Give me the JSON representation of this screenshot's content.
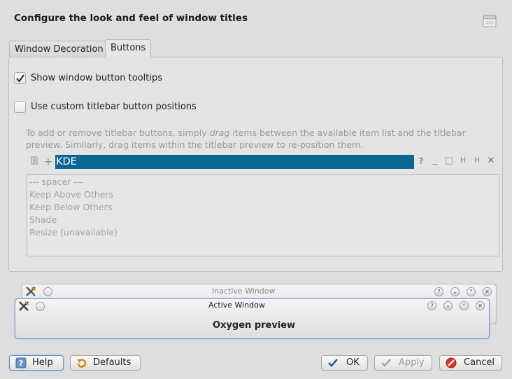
{
  "dialog": {
    "title": "Configure the look and feel of window titles"
  },
  "tabs": [
    {
      "label": "Window Decoration",
      "active": false
    },
    {
      "label": "Buttons",
      "active": true
    }
  ],
  "options": {
    "tooltips_label": "Show window button tooltips",
    "tooltips_checked": true,
    "custom_positions_label": "Use custom titlebar button positions",
    "custom_positions_checked": false
  },
  "hint": {
    "before": "To add or remove titlebar buttons, simply ",
    "emph": "drag",
    "after": " items between the available item list and the titlebar preview. Similarly, drag items within the titlebar preview to re-position them."
  },
  "titlebar_preview": {
    "left_icons": [
      "menu-icon",
      "plus-icon"
    ],
    "text": "KDE",
    "right_icons": [
      "?",
      "_",
      "□",
      "H",
      "H",
      "✕"
    ]
  },
  "available_items": [
    "--- spacer ---",
    "Keep Above Others",
    "Keep Below Others",
    "Shade",
    "Resize (unavailable)"
  ],
  "preview": {
    "inactive_title": "Inactive Window",
    "active_title": "Active Window",
    "body_text": "Oxygen preview"
  },
  "buttons": {
    "help": "Help",
    "defaults": "Defaults",
    "ok": "OK",
    "apply": "Apply",
    "cancel": "Cancel"
  },
  "colors": {
    "selection": "#0c6691",
    "background": "#dedede"
  }
}
